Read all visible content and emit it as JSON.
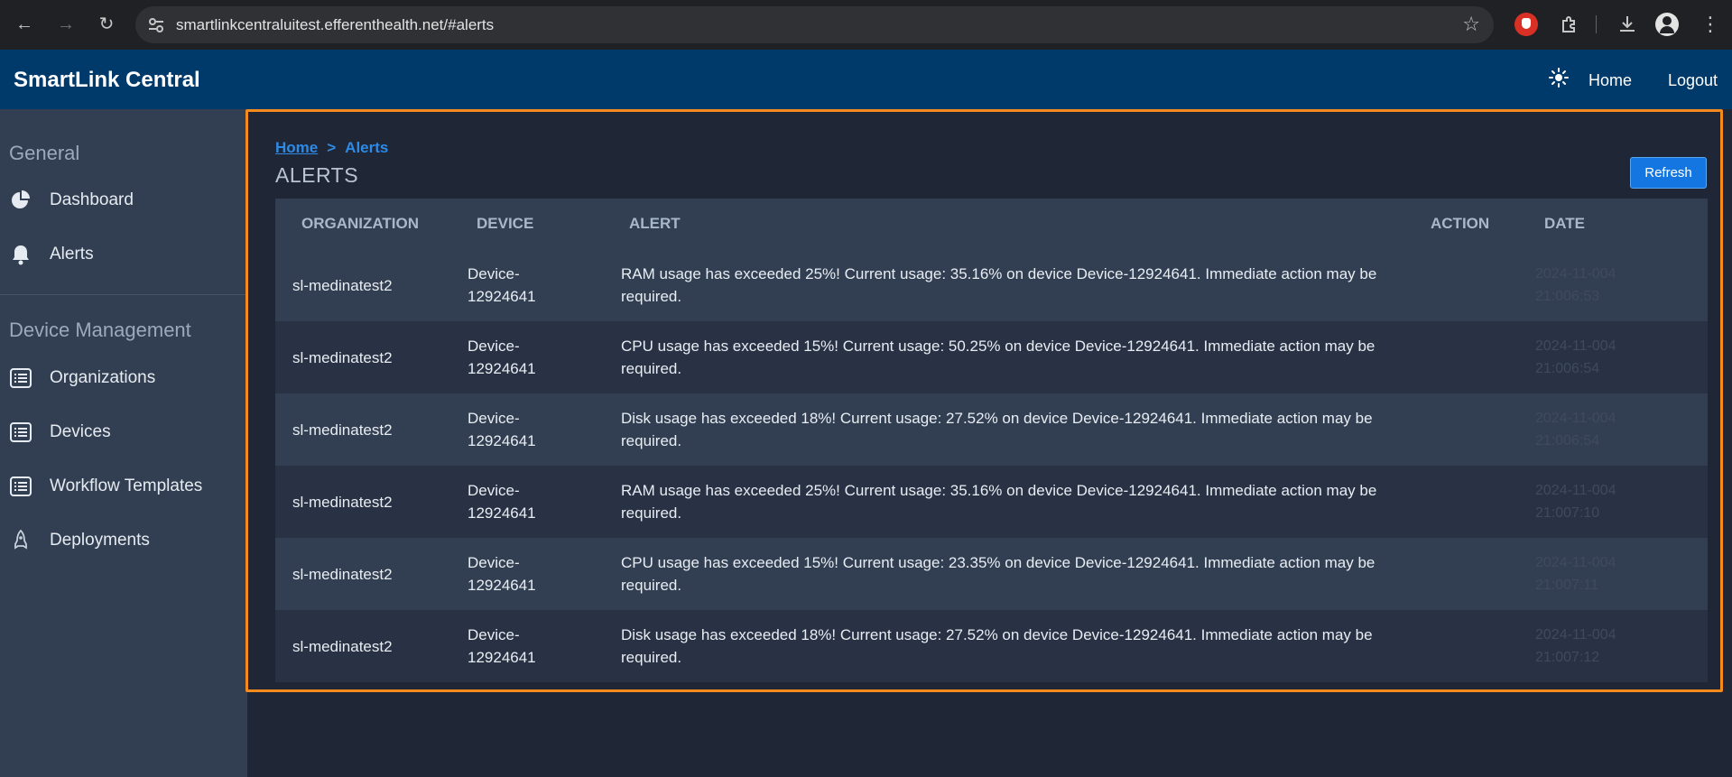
{
  "browser": {
    "url": "smartlinkcentraluitest.efferenthealth.net/#alerts"
  },
  "header": {
    "brand": "SmartLink Central",
    "home_label": "Home",
    "logout_label": "Logout"
  },
  "sidebar": {
    "general_title": "General",
    "device_mgmt_title": "Device Management",
    "items": [
      {
        "label": "Dashboard",
        "icon": "pie-chart-icon"
      },
      {
        "label": "Alerts",
        "icon": "bell-icon"
      },
      {
        "label": "Organizations",
        "icon": "list-icon"
      },
      {
        "label": "Devices",
        "icon": "list-icon"
      },
      {
        "label": "Workflow Templates",
        "icon": "list-icon"
      },
      {
        "label": "Deployments",
        "icon": "rocket-icon"
      }
    ]
  },
  "breadcrumb": {
    "home": "Home",
    "separator": ">",
    "current": "Alerts"
  },
  "page": {
    "title": "ALERTS",
    "refresh_label": "Refresh"
  },
  "table": {
    "headers": {
      "organization": "ORGANIZATION",
      "device": "DEVICE",
      "alert": "ALERT",
      "action": "ACTION",
      "date": "DATE"
    },
    "rows": [
      {
        "organization": "sl-medinatest2",
        "device": "Device-12924641",
        "alert": "RAM usage has exceeded 25%! Current usage: 35.16% on device Device-12924641. Immediate action may be required.",
        "action": "",
        "date": "2024-11-004 21:006:53"
      },
      {
        "organization": "sl-medinatest2",
        "device": "Device-12924641",
        "alert": "CPU usage has exceeded 15%! Current usage: 50.25% on device Device-12924641. Immediate action may be required.",
        "action": "",
        "date": "2024-11-004 21:006:54"
      },
      {
        "organization": "sl-medinatest2",
        "device": "Device-12924641",
        "alert": "Disk usage has exceeded 18%! Current usage: 27.52% on device Device-12924641. Immediate action may be required.",
        "action": "",
        "date": "2024-11-004 21:006:54"
      },
      {
        "organization": "sl-medinatest2",
        "device": "Device-12924641",
        "alert": "RAM usage has exceeded 25%! Current usage: 35.16% on device Device-12924641. Immediate action may be required.",
        "action": "",
        "date": "2024-11-004 21:007:10"
      },
      {
        "organization": "sl-medinatest2",
        "device": "Device-12924641",
        "alert": "CPU usage has exceeded 15%! Current usage: 23.35% on device Device-12924641. Immediate action may be required.",
        "action": "",
        "date": "2024-11-004 21:007:11"
      },
      {
        "organization": "sl-medinatest2",
        "device": "Device-12924641",
        "alert": "Disk usage has exceeded 18%! Current usage: 27.52% on device Device-12924641. Immediate action may be required.",
        "action": "",
        "date": "2024-11-004 21:007:12"
      }
    ]
  },
  "colors": {
    "header_bg": "#003a6b",
    "sidebar_bg": "#323f52",
    "main_bg": "#1f2737",
    "accent": "#1476e0",
    "highlight": "#f58a1f"
  }
}
